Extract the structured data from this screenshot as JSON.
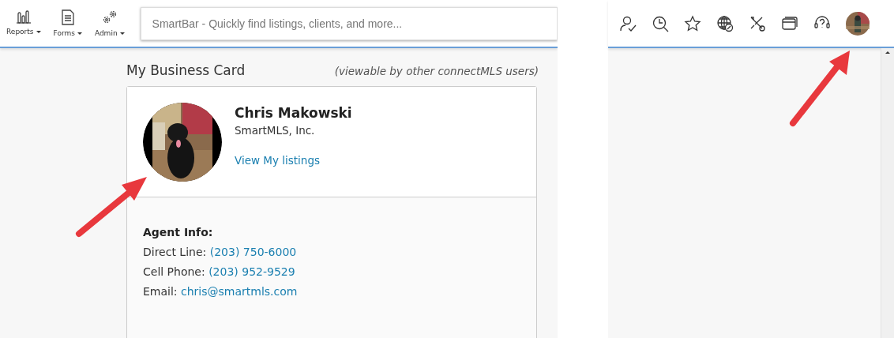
{
  "toolbar": {
    "menus": [
      {
        "label": "Reports"
      },
      {
        "label": "Forms"
      },
      {
        "label": "Admin"
      }
    ],
    "search": {
      "placeholder": "SmartBar - Quickly find listings, clients, and more..."
    }
  },
  "business_card": {
    "heading": "My Business Card",
    "note": "(viewable by other connectMLS users)",
    "name": "Chris Makowski",
    "company": "SmartMLS, Inc.",
    "listings_link": "View My listings",
    "info_title": "Agent Info:",
    "info": [
      {
        "label": "Direct Line:",
        "value": "(203) 750-6000"
      },
      {
        "label": "Cell Phone:",
        "value": "(203) 952-9529"
      },
      {
        "label": "Email:",
        "value": "chris@smartmls.com"
      }
    ]
  }
}
